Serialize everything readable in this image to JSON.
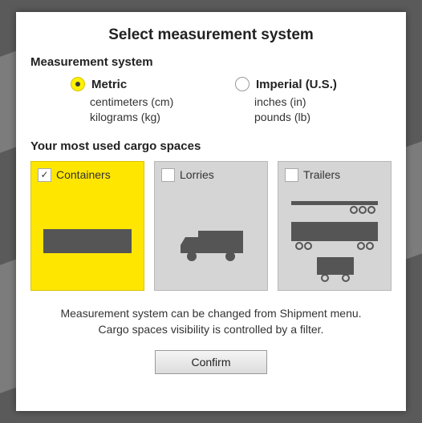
{
  "title": "Select measurement system",
  "measurement": {
    "section_label": "Measurement system",
    "options": [
      {
        "value": "metric",
        "selected": true,
        "label": "Metric",
        "desc1": "centimeters (cm)",
        "desc2": "kilograms (kg)"
      },
      {
        "value": "imperial",
        "selected": false,
        "label": "Imperial (U.S.)",
        "desc1": "inches (in)",
        "desc2": "pounds (lb)"
      }
    ]
  },
  "cargo": {
    "section_label": "Your most used cargo spaces",
    "cards": [
      {
        "key": "containers",
        "label": "Containers",
        "checked": true
      },
      {
        "key": "lorries",
        "label": "Lorries",
        "checked": false
      },
      {
        "key": "trailers",
        "label": "Trailers",
        "checked": false
      }
    ]
  },
  "footnote": {
    "line1": "Measurement system can be changed from Shipment menu.",
    "line2": "Cargo spaces visibility is controlled by a filter."
  },
  "confirm_label": "Confirm"
}
